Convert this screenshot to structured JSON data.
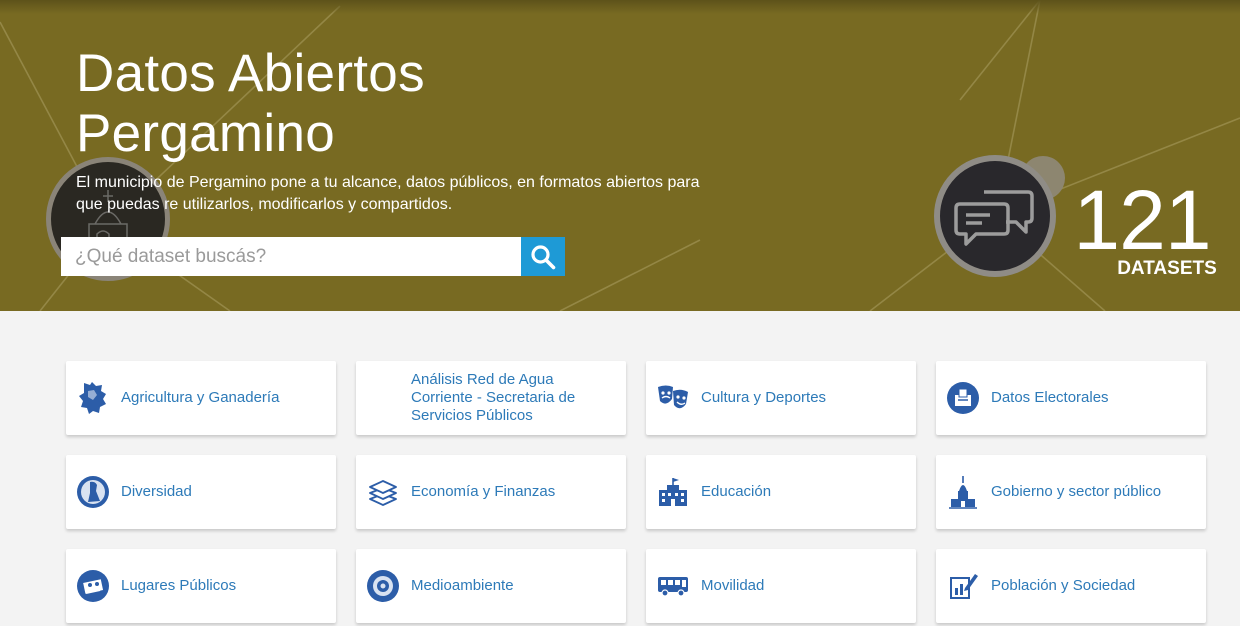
{
  "hero": {
    "title_line1": "Datos Abiertos",
    "title_line2": "Pergamino",
    "description": "El municipio de Pergamino pone a tu alcance, datos públicos, en formatos abiertos para que puedas re utilizarlos, modificarlos y compartidos.",
    "background_color": "#786a22"
  },
  "search": {
    "placeholder": "¿Qué dataset buscás?",
    "button_color": "#1e9ad6",
    "button_icon": "search-icon"
  },
  "stats": {
    "count": "121",
    "label": "DATASETS",
    "icon": "chat-bubbles-icon"
  },
  "categories": [
    {
      "label": "Agricultura y Ganadería",
      "icon": "map-region-icon"
    },
    {
      "label": "Análisis Red de Agua Corriente - Secretaria de Servicios Públicos",
      "icon": ""
    },
    {
      "label": "Cultura y Deportes",
      "icon": "theater-masks-icon"
    },
    {
      "label": "Datos Electorales",
      "icon": "ballot-box-icon"
    },
    {
      "label": "Diversidad",
      "icon": "diversity-icon"
    },
    {
      "label": "Economía y Finanzas",
      "icon": "layers-icon"
    },
    {
      "label": "Educación",
      "icon": "school-building-icon"
    },
    {
      "label": "Gobierno y sector público",
      "icon": "government-building-icon"
    },
    {
      "label": "Lugares Públicos",
      "icon": "public-places-icon"
    },
    {
      "label": "Medioambiente",
      "icon": "environment-icon"
    },
    {
      "label": "Movilidad",
      "icon": "bus-icon"
    },
    {
      "label": "Población y Sociedad",
      "icon": "chart-pen-icon"
    }
  ],
  "colors": {
    "link": "#2d7ab8",
    "icon": "#2c5da8",
    "page_bg": "#f3f3f3"
  }
}
